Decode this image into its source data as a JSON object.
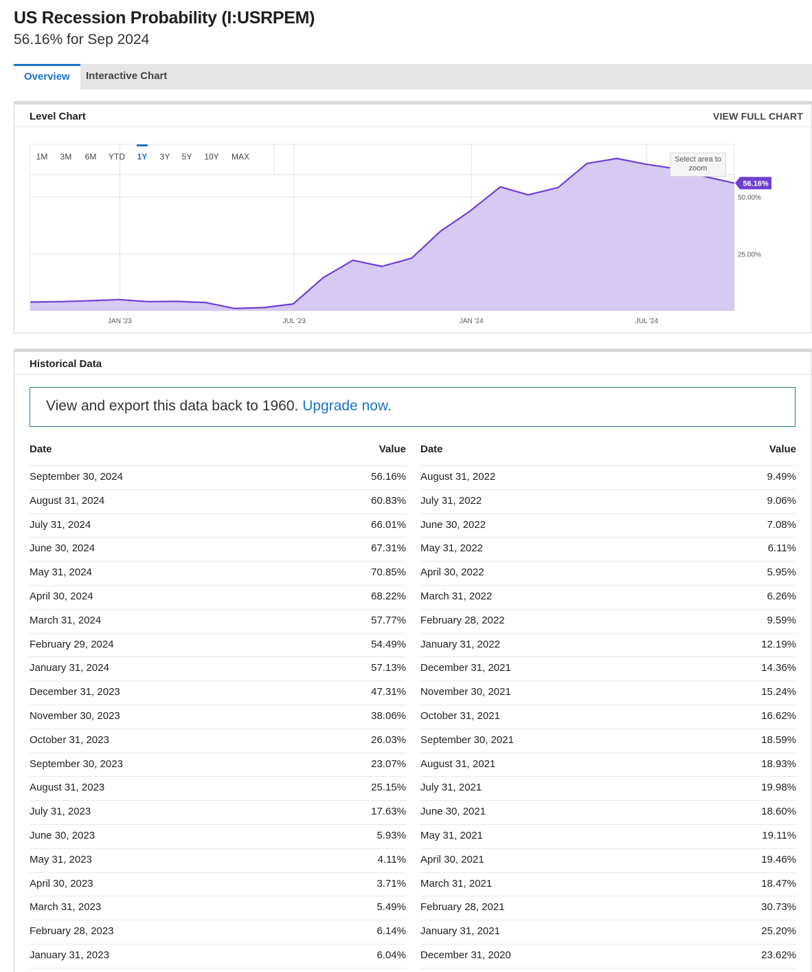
{
  "header": {
    "title": "US Recession Probability (I:USRPEM)",
    "subtitle": "56.16% for Sep 2024"
  },
  "tabs": [
    {
      "label": "Overview",
      "active": true
    },
    {
      "label": "Interactive Chart",
      "active": false
    }
  ],
  "level_chart": {
    "panel_title": "Level Chart",
    "view_full_label": "VIEW FULL CHART",
    "ranges": [
      "1M",
      "3M",
      "6M",
      "YTD",
      "1Y",
      "3Y",
      "5Y",
      "10Y",
      "MAX"
    ],
    "active_range": "1Y",
    "zoom_hint": "Select area to zoom",
    "last_value_label": "56.16%"
  },
  "chart_data": {
    "type": "area",
    "title": "",
    "xlabel": "",
    "ylabel": "",
    "x_ticks": [
      "JAN '23",
      "JUL '23",
      "JAN '24",
      "JUL '24"
    ],
    "y_ticks": [
      "25.00%",
      "50.00%"
    ],
    "ylim": [
      0,
      72
    ],
    "grid": true,
    "color": "#6e3fd3",
    "fill": "#d6c9f2",
    "x": [
      "2022-09-30",
      "2022-10-31",
      "2022-11-30",
      "2022-12-31",
      "2023-01-31",
      "2023-02-28",
      "2023-03-31",
      "2023-04-30",
      "2023-05-31",
      "2023-06-30",
      "2023-07-31",
      "2023-08-31",
      "2023-09-30",
      "2023-10-31",
      "2023-11-30",
      "2023-12-31",
      "2024-01-31",
      "2024-02-29",
      "2024-03-31",
      "2024-04-30",
      "2024-05-31",
      "2024-06-30",
      "2024-07-31",
      "2024-08-31",
      "2024-09-30"
    ],
    "values": [
      3.8,
      4.0,
      4.4,
      4.9,
      4.0,
      4.1,
      3.6,
      1.0,
      1.4,
      3.0,
      14.5,
      22.2,
      19.5,
      23.1,
      35.0,
      44.0,
      54.5,
      51.0,
      54.2,
      64.8,
      67.0,
      64.5,
      62.5,
      59.0,
      56.16
    ]
  },
  "historical": {
    "panel_title": "Historical Data",
    "upgrade_text": "View and export this data back to 1960.",
    "upgrade_link": "Upgrade now.",
    "col_date": "Date",
    "col_value": "Value",
    "left": [
      {
        "date": "September 30, 2024",
        "value": "56.16%"
      },
      {
        "date": "August 31, 2024",
        "value": "60.83%"
      },
      {
        "date": "July 31, 2024",
        "value": "66.01%"
      },
      {
        "date": "June 30, 2024",
        "value": "67.31%"
      },
      {
        "date": "May 31, 2024",
        "value": "70.85%"
      },
      {
        "date": "April 30, 2024",
        "value": "68.22%"
      },
      {
        "date": "March 31, 2024",
        "value": "57.77%"
      },
      {
        "date": "February 29, 2024",
        "value": "54.49%"
      },
      {
        "date": "January 31, 2024",
        "value": "57.13%"
      },
      {
        "date": "December 31, 2023",
        "value": "47.31%"
      },
      {
        "date": "November 30, 2023",
        "value": "38.06%"
      },
      {
        "date": "October 31, 2023",
        "value": "26.03%"
      },
      {
        "date": "September 30, 2023",
        "value": "23.07%"
      },
      {
        "date": "August 31, 2023",
        "value": "25.15%"
      },
      {
        "date": "July 31, 2023",
        "value": "17.63%"
      },
      {
        "date": "June 30, 2023",
        "value": "5.93%"
      },
      {
        "date": "May 31, 2023",
        "value": "4.11%"
      },
      {
        "date": "April 30, 2023",
        "value": "3.71%"
      },
      {
        "date": "March 31, 2023",
        "value": "5.49%"
      },
      {
        "date": "February 28, 2023",
        "value": "6.14%"
      },
      {
        "date": "January 31, 2023",
        "value": "6.04%"
      }
    ],
    "right": [
      {
        "date": "August 31, 2022",
        "value": "9.49%"
      },
      {
        "date": "July 31, 2022",
        "value": "9.06%"
      },
      {
        "date": "June 30, 2022",
        "value": "7.08%"
      },
      {
        "date": "May 31, 2022",
        "value": "6.11%"
      },
      {
        "date": "April 30, 2022",
        "value": "5.95%"
      },
      {
        "date": "March 31, 2022",
        "value": "6.26%"
      },
      {
        "date": "February 28, 2022",
        "value": "9.59%"
      },
      {
        "date": "January 31, 2022",
        "value": "12.19%"
      },
      {
        "date": "December 31, 2021",
        "value": "14.36%"
      },
      {
        "date": "November 30, 2021",
        "value": "15.24%"
      },
      {
        "date": "October 31, 2021",
        "value": "16.62%"
      },
      {
        "date": "September 30, 2021",
        "value": "18.59%"
      },
      {
        "date": "August 31, 2021",
        "value": "18.93%"
      },
      {
        "date": "July 31, 2021",
        "value": "19.98%"
      },
      {
        "date": "June 30, 2021",
        "value": "18.60%"
      },
      {
        "date": "May 31, 2021",
        "value": "19.11%"
      },
      {
        "date": "April 30, 2021",
        "value": "19.46%"
      },
      {
        "date": "March 31, 2021",
        "value": "18.47%"
      },
      {
        "date": "February 28, 2021",
        "value": "30.73%"
      },
      {
        "date": "January 31, 2021",
        "value": "25.20%"
      },
      {
        "date": "December 31, 2020",
        "value": "23.62%"
      }
    ]
  }
}
